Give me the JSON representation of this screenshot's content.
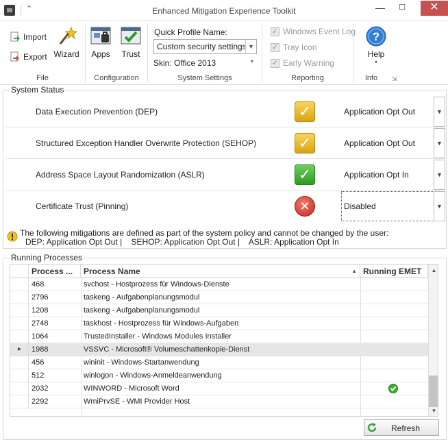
{
  "window": {
    "title": "Enhanced Mitigation Experience Toolkit",
    "minimize": "—",
    "maximize": "☐",
    "close": "✕",
    "qat_chevron": "⌃"
  },
  "ribbon": {
    "file": {
      "import": "Import",
      "export": "Export",
      "wizard": "Wizard",
      "label": "File"
    },
    "configuration": {
      "apps": "Apps",
      "trust": "Trust",
      "label": "Configuration"
    },
    "system_settings": {
      "profile_label": "Quick Profile Name:",
      "profile_value": "Custom security settings",
      "skin": "Skin: Office 2013",
      "label": "System Settings"
    },
    "reporting": {
      "event_log": "Windows Event Log",
      "tray_icon": "Tray Icon",
      "early_warning": "Early Warning",
      "label": "Reporting"
    },
    "info": {
      "help": "Help",
      "label": "Info"
    }
  },
  "system_status": {
    "legend": "System Status",
    "rows": [
      {
        "name": "Data Execution Prevention (DEP)",
        "value": "Application Opt Out",
        "state": "warning"
      },
      {
        "name": "Structured Exception Handler Overwrite Protection (SEHOP)",
        "value": "Application Opt Out",
        "state": "warning"
      },
      {
        "name": "Address Space Layout Randomization (ASLR)",
        "value": "Application Opt In",
        "state": "ok"
      },
      {
        "name": "Certificate Trust (Pinning)",
        "value": "Disabled",
        "state": "error"
      }
    ],
    "note_line1": "The following mitigations are defined as part of the system policy and cannot be changed by the user:",
    "note_line2": "DEP: Application Opt Out |    SEHOP: Application Opt Out |    ASLR: Application Opt In"
  },
  "processes": {
    "legend": "Running Processes",
    "columns": [
      "Process ...",
      "Process Name",
      "Running EMET"
    ],
    "rows": [
      {
        "pid": "468",
        "name": "svchost - Hostprozess für Windows-Dienste",
        "emet": false
      },
      {
        "pid": "2796",
        "name": "taskeng - Aufgabenplanungsmodul",
        "emet": false
      },
      {
        "pid": "1208",
        "name": "taskeng - Aufgabenplanungsmodul",
        "emet": false
      },
      {
        "pid": "2748",
        "name": "taskhost - Hostprozess für Windows-Aufgaben",
        "emet": false
      },
      {
        "pid": "1064",
        "name": "TrustedInstaller - Windows Modules Installer",
        "emet": false
      },
      {
        "pid": "1988",
        "name": "VSSVC - Microsoft® Volumeschattenkopie-Dienst",
        "emet": false
      },
      {
        "pid": "456",
        "name": "wininit - Windows-Startanwendung",
        "emet": false
      },
      {
        "pid": "512",
        "name": "winlogon - Windows-Anmeldeanwendung",
        "emet": false
      },
      {
        "pid": "2032",
        "name": "WINWORD - Microsoft Word",
        "emet": true
      },
      {
        "pid": "2292",
        "name": "WmiPrvSE - WMI Provider Host",
        "emet": false
      }
    ],
    "selected_index": 5,
    "refresh": "Refresh"
  },
  "colors": {
    "warning": "#e0ae24",
    "ok": "#3dae30",
    "error": "#d23a2b",
    "close": "#c75050"
  }
}
